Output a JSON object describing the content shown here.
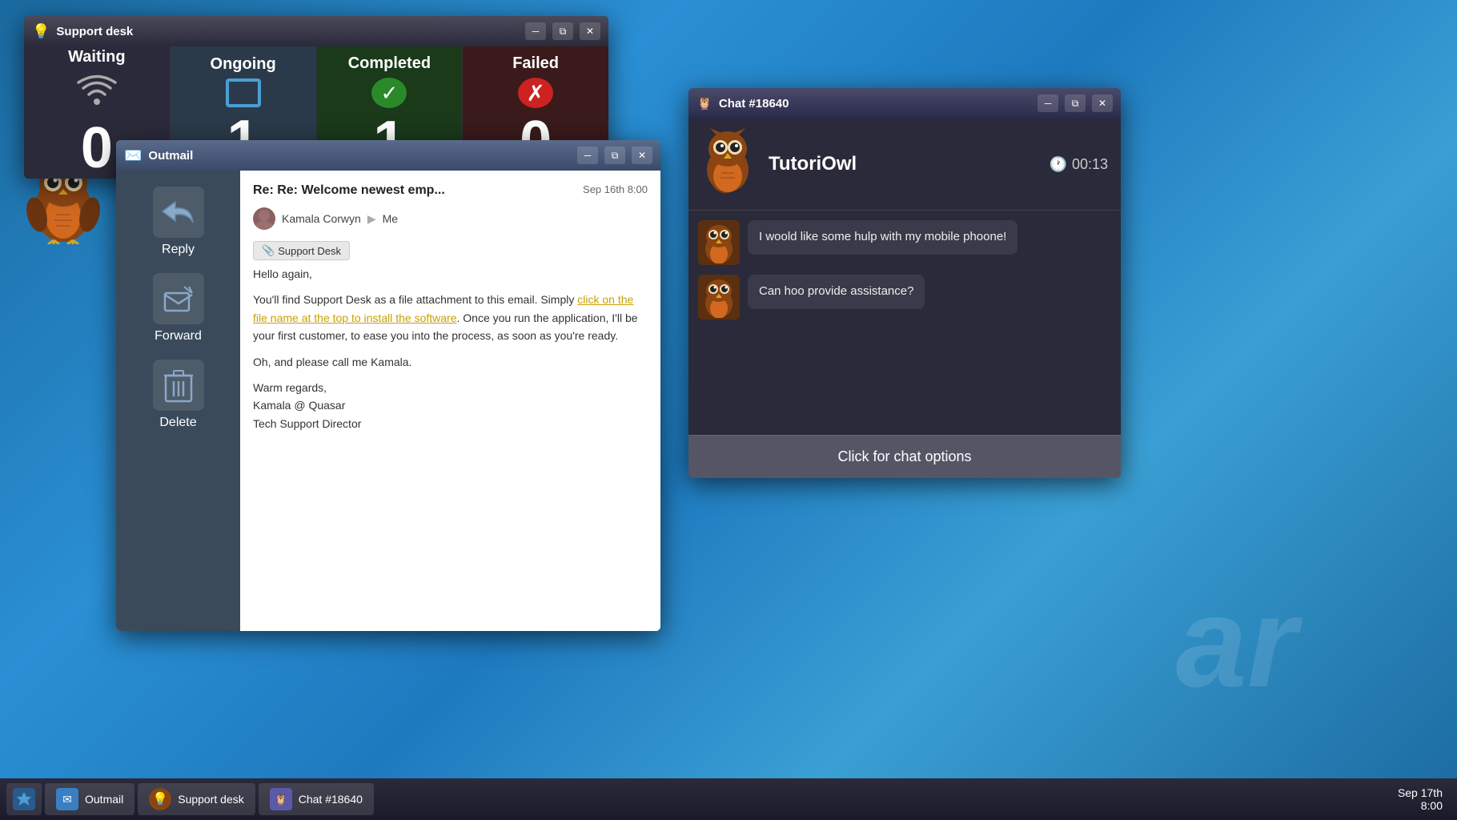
{
  "desktop": {
    "watermark": "ar"
  },
  "taskbar": {
    "system_btn": "❖",
    "outmail_label": "Outmail",
    "support_label": "Support desk",
    "chat_label": "Chat #18640",
    "clock_date": "Sep 17th",
    "clock_time": "8:00"
  },
  "support_window": {
    "title": "Support desk",
    "stats": [
      {
        "id": "waiting",
        "label": "Waiting",
        "value": "0",
        "type": "waiting"
      },
      {
        "id": "ongoing",
        "label": "Ongoing",
        "value": "1",
        "type": "ongoing"
      },
      {
        "id": "completed",
        "label": "Completed",
        "value": "1",
        "type": "completed"
      },
      {
        "id": "failed",
        "label": "Failed",
        "value": "0",
        "type": "failed"
      }
    ]
  },
  "outmail_window": {
    "title": "Outmail",
    "actions": [
      {
        "id": "reply",
        "label": "Reply",
        "icon": "↩"
      },
      {
        "id": "forward",
        "label": "Forward",
        "icon": "✉"
      },
      {
        "id": "delete",
        "label": "Delete",
        "icon": "🗑"
      }
    ],
    "email": {
      "subject": "Re: Re: Welcome newest emp...",
      "date": "Sep 16th 8:00",
      "from": "Kamala Corwyn",
      "to": "Me",
      "attachment": "Support Desk",
      "body_lines": [
        "Hello again,",
        "",
        "You'll find Support Desk as a file attachment to this email. Simply click on the file name at the top to install the software. Once you run the application, I'll be your first customer, to ease you into the process, as soon as you're ready.",
        "",
        "Oh, and please call me Kamala.",
        "",
        "Warm regards,",
        "Kamala @ Quasar",
        "Tech Support Director"
      ],
      "link_text": "click on the file name at the top to install the software"
    }
  },
  "chat_window": {
    "title": "Chat #18640",
    "user_name": "TutoriOwl",
    "timer": "00:13",
    "messages": [
      {
        "id": 1,
        "text": "I woold like some hulp with my mobile phoone!"
      },
      {
        "id": 2,
        "text": "Can hoo provide assistance?"
      }
    ],
    "options_btn": "Click for chat options"
  }
}
